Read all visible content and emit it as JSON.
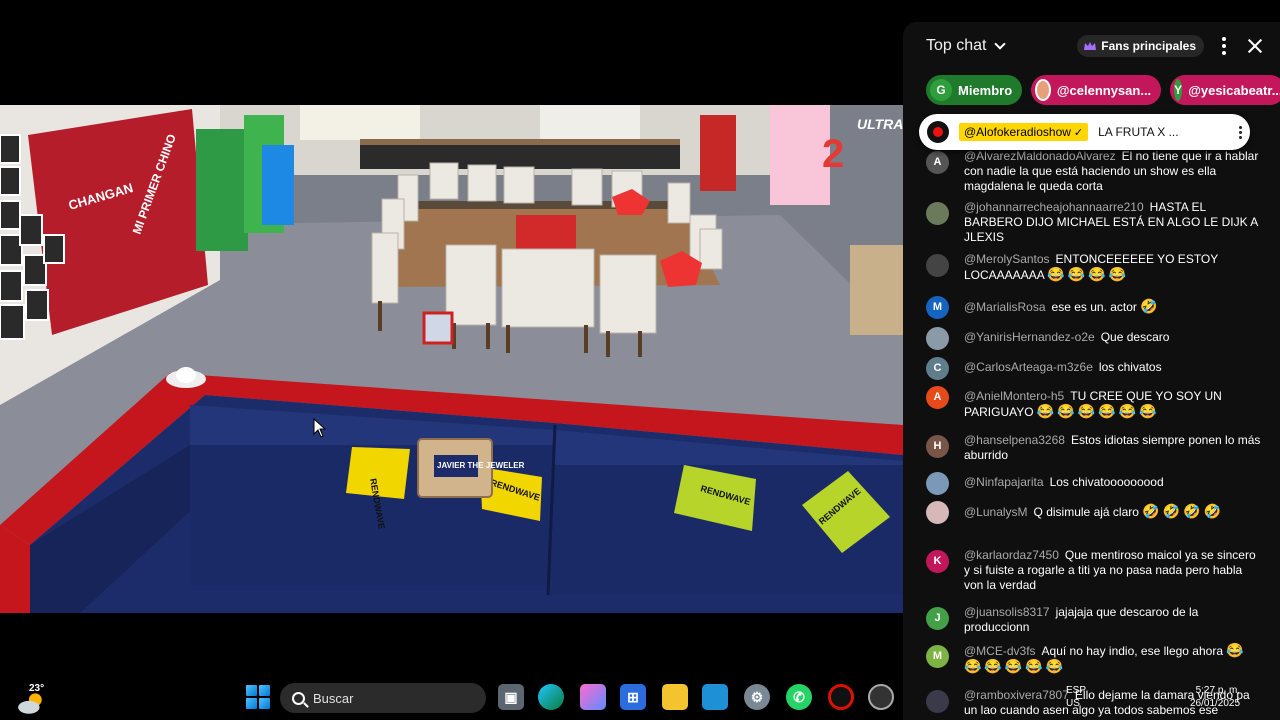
{
  "chat": {
    "title": "Top chat",
    "fans_label": "Fans principales",
    "chips": [
      {
        "initial": "G",
        "label": "Miembro"
      },
      {
        "initial": "",
        "label": "@celennysan..."
      },
      {
        "initial": "Y",
        "label": "@yesicabeatr..."
      }
    ],
    "pinned": {
      "author": "@Alofokeradioshow",
      "verified": "✓",
      "text": "LA FRUTA X ..."
    },
    "messages": [
      {
        "initial": "A",
        "color": "#555555",
        "author": "@AlvarezMaldonadoAlvarez",
        "text": "El no tiene que ir a hablar con nadie la que está haciendo un show es ella magdalena le queda corta"
      },
      {
        "initial": "",
        "color": "#6b7a5a",
        "author": "@johannarrecheajohannaarre210",
        "text": "HASTA EL BARBERO DIJO MICHAEL ESTÁ EN ALGO LE DIJK A JLEXIS"
      },
      {
        "initial": "",
        "color": "#444444",
        "author": "@MerolySantos",
        "text": "ENTONCEEEEEE YO ESTOY LOCAAAAAAA",
        "emoji": "😂😂😂😂"
      },
      {
        "initial": "M",
        "color": "#1565c0",
        "author": "@MarialisRosa",
        "text": "ese es un. actor",
        "emoji": "🤣"
      },
      {
        "initial": "",
        "color": "#8a9aa6",
        "author": "@YanirisHernandez-o2e",
        "text": "Que descaro"
      },
      {
        "initial": "C",
        "color": "#607d8b",
        "author": "@CarlosArteaga-m3z6e",
        "text": "los chivatos"
      },
      {
        "initial": "A",
        "color": "#e64a19",
        "author": "@AnielMontero-h5",
        "text": "TU CREE QUE YO SOY UN PARIGUAYO",
        "emoji": "😂😂😂😂😂😂"
      },
      {
        "initial": "H",
        "color": "#795548",
        "author": "@hanselpena3268",
        "text": "Estos idiotas siempre ponen lo más aburrido"
      },
      {
        "initial": "",
        "color": "#7c98b8",
        "author": "@Ninfapajarita",
        "text": "Los chivatooooooood"
      },
      {
        "initial": "",
        "color": "#d7b8b8",
        "author": "@LunalysM",
        "text": "Q disimule ajá claro",
        "emoji": "🤣🤣🤣🤣"
      },
      {
        "initial": "K",
        "color": "#c2185b",
        "author": "@karlaordaz7450",
        "text": "Que mentiroso maicol ya se sincero y si fuiste a rogarle a titi ya no pasa nada pero habla von la verdad"
      },
      {
        "initial": "J",
        "color": "#43a047",
        "author": "@juansolis8317",
        "text": "jajajaja que descaroo de la produccionn"
      },
      {
        "initial": "M",
        "color": "#7cb342",
        "author": "@MCE-dv3fs",
        "text": "Aquí no hay indio, ese llego ahora",
        "emoji": "😂😂😂😂😂😂"
      },
      {
        "initial": "",
        "color": "#3a3a4a",
        "author": "@ramboxivera7807",
        "text": "Ello dejame la damara viendo pa un lao cuando asen algo ya todos sabemos ese"
      }
    ]
  },
  "video": {
    "brand_left": "CHANGAN",
    "brand_left_sub": "MI PRIMER CHINO",
    "brand_right": "ULTRA",
    "pillow_text": "RENDWAVE",
    "bag_text": "JAVIER THE JEWELER",
    "counter_number": "2"
  },
  "taskbar": {
    "weather_temp": "23°",
    "search_label": "Buscar",
    "lang_line1": "ESP",
    "lang_line2": "US",
    "time": "5:27 p. m.",
    "date": "26/01/2025"
  },
  "colors": {
    "chat_bg": "#0f0f0f",
    "member_green": "#1f7a2b",
    "user_pink": "#c2185b",
    "pinned_yellow": "#ffd600",
    "sofa_blue": "#1c2c6a",
    "sofa_red": "#c4161c"
  }
}
